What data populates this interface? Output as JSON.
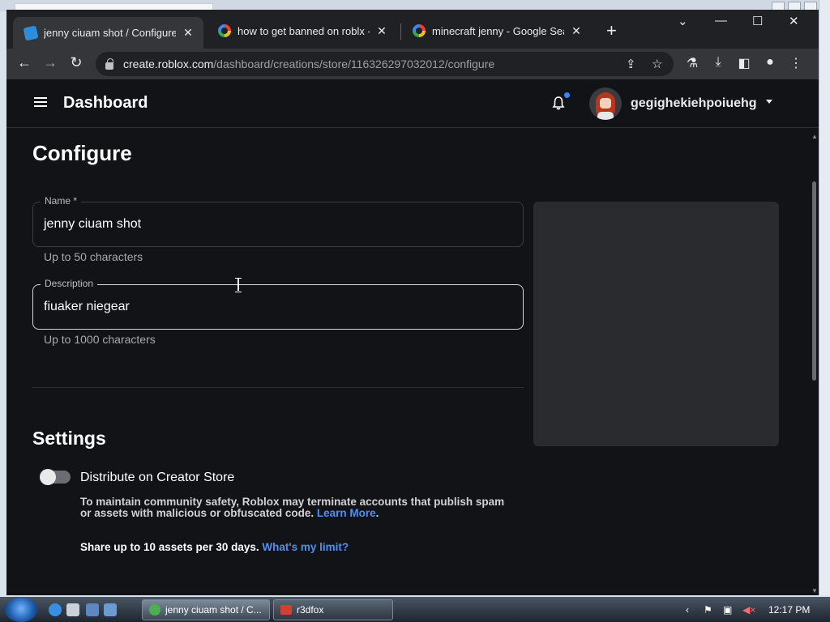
{
  "browser": {
    "tabs": [
      {
        "title": "jenny ciuam shot / Configure",
        "close": "✕"
      },
      {
        "title": "how to get banned on roblx - G",
        "close": "✕"
      },
      {
        "title": "minecraft jenny - Google Search",
        "close": "✕"
      }
    ],
    "new_tab": "+",
    "window_controls": {
      "dropdown": "⌄",
      "minimize": "—",
      "maximize": "☐",
      "close": "✕"
    },
    "nav": {
      "back": "←",
      "forward": "→",
      "reload": "↻"
    },
    "url_host": "create.roblox.com",
    "url_path": "/dashboard/creations/store/116326297032012/configure",
    "toolbar_icons": [
      "share-icon",
      "star-icon",
      "labs-icon",
      "download-icon",
      "side-panel-icon",
      "profile-icon",
      "menu-icon"
    ]
  },
  "header": {
    "title": "Dashboard",
    "username": "gegighekiehpoiuehg"
  },
  "main": {
    "heading": "Configure",
    "name_field": {
      "label": "Name *",
      "value": "jenny ciuam shot",
      "helper": "Up to 50 characters"
    },
    "description_field": {
      "label": "Description",
      "value": "fiuaker niegear",
      "helper": "Up to 1000 characters"
    },
    "settings_heading": "Settings",
    "distribute_toggle": {
      "label": "Distribute on Creator Store",
      "on": false
    },
    "notice_text": "To maintain community safety, Roblox may terminate accounts that publish spam or assets with malicious or obfuscated code.",
    "learn_more": "Learn More",
    "notice_end": ".",
    "share_text": "Share up to 10 assets per 30 days.",
    "limit_link": "What's my limit?"
  },
  "taskbar": {
    "buttons": [
      {
        "label": "jenny ciuam shot / C..."
      },
      {
        "label": "r3dfox"
      }
    ],
    "clock": "12:17 PM"
  },
  "colors": {
    "accent": "#4d8ff7",
    "page_bg": "#121317",
    "notification_dot": "#3a83f6"
  }
}
